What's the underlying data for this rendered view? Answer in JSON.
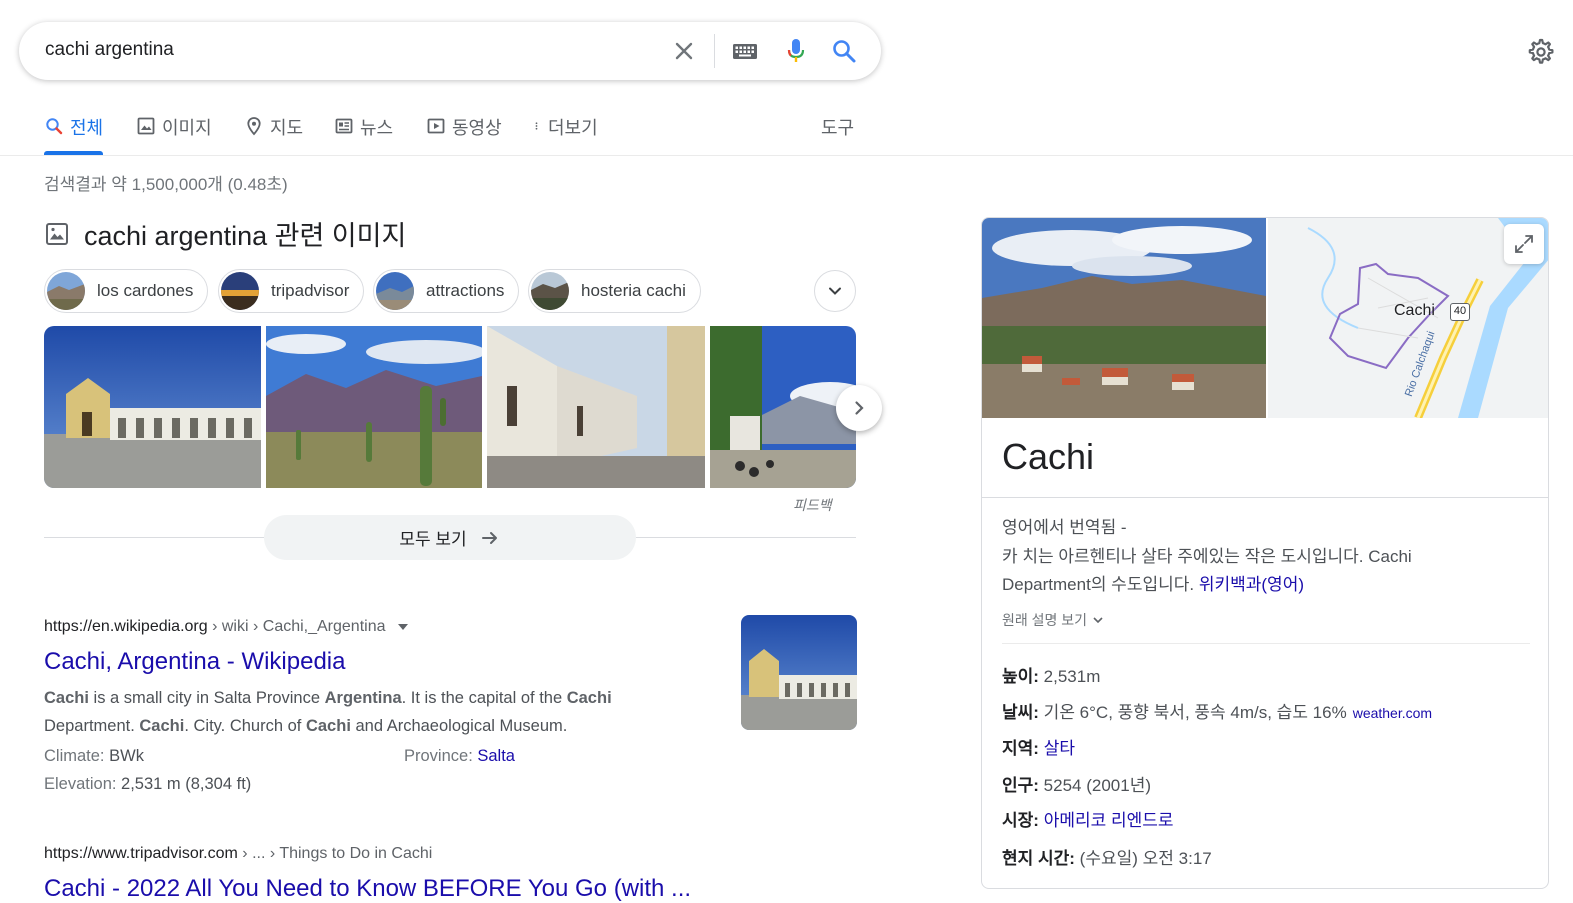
{
  "search": {
    "query": "cachi argentina"
  },
  "tabs": [
    {
      "label": "전체"
    },
    {
      "label": "이미지"
    },
    {
      "label": "지도"
    },
    {
      "label": "뉴스"
    },
    {
      "label": "동영상"
    },
    {
      "label": "더보기"
    }
  ],
  "tools_label": "도구",
  "result_stats": "검색결과 약 1,500,000개 (0.48초)",
  "images_block": {
    "title": "cachi argentina 관련 이미지",
    "chips": [
      "los cardones",
      "tripadvisor",
      "attractions",
      "hosteria cachi"
    ],
    "feedback": "피드백",
    "view_all": "모두 보기"
  },
  "results": [
    {
      "domain": "https://en.wikipedia.org",
      "path": " › wiki › Cachi,_Argentina",
      "title": "Cachi, Argentina - Wikipedia",
      "snippet": [
        {
          "b": "Cachi",
          "t": " is a small city in Salta Province "
        },
        {
          "b": "Argentina",
          "t": ". It is the capital of the "
        },
        {
          "b": "Cachi",
          "t": " Department. "
        },
        {
          "b": "Cachi",
          "t": ". City. Church of "
        },
        {
          "b": "Cachi",
          "t": " and Archaeological Museum."
        }
      ],
      "attrs": {
        "climate_label": "Climate: ",
        "climate_value": "BWk",
        "province_label": "Province: ",
        "province_value": "Salta",
        "elevation_label": "Elevation: ",
        "elevation_value": "2,531 m (8,304 ft)"
      }
    },
    {
      "domain": "https://www.tripadvisor.com",
      "path": " › ... › Things to Do in Cachi",
      "title": "Cachi - 2022 All You Need to Know BEFORE You Go (with ..."
    }
  ],
  "knowledge_panel": {
    "title": "Cachi",
    "map_label": "Cachi",
    "map_route": "40",
    "map_river": "Rio Calchaqui",
    "translated_note": "영어에서 번역됨 -",
    "description_1": "카 치는 아르헨티나 살타 주에있는 작은 도시입니다. Cachi",
    "description_2": "Department의 수도입니다. ",
    "source_link": "위키백과(영어)",
    "original_desc": "원래 설명 보기",
    "facts": [
      {
        "label": "높이:",
        "value": " 2,531m"
      },
      {
        "label": "날씨:",
        "value": " 기온 6°C, 풍향 북서, 풍속 4m/s, 습도 16%",
        "source": "weather.com"
      },
      {
        "label": "지역:",
        "link": "살타"
      },
      {
        "label": "인구:",
        "value": " 5254 (2001년)"
      },
      {
        "label": "시장:",
        "link": "아메리코 리엔드로"
      },
      {
        "label": "현지 시간:",
        "value": " (수요일) 오전 3:17"
      }
    ]
  },
  "colors": {
    "accent": "#1a73e8",
    "link": "#1a0dab",
    "text": "#202124",
    "muted": "#70757a"
  }
}
